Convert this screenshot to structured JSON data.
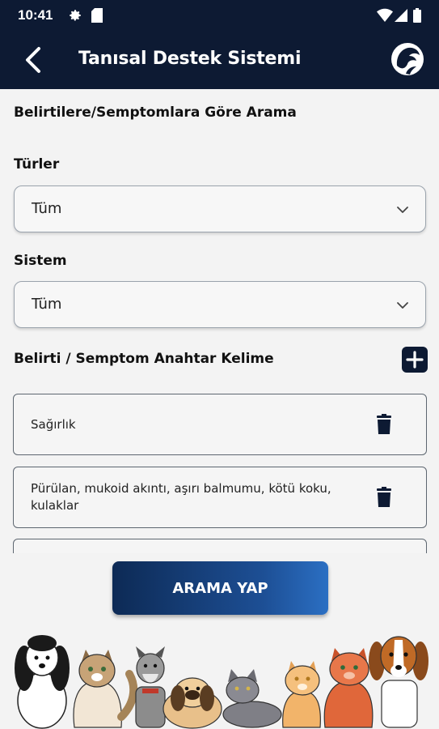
{
  "status_bar": {
    "time": "10:41"
  },
  "header": {
    "title": "Tanısal Destek Sistemi"
  },
  "search": {
    "section_title": "Belirtilere/Semptomlara Göre Arama",
    "species_label": "Türler",
    "species_value": "Tüm",
    "system_label": "Sistem",
    "system_value": "Tüm",
    "keyword_label": "Belirti / Semptom Anahtar Kelime",
    "keywords": [
      "Sağırlık",
      "Pürülan, mukoid akıntı, aşırı balmumu, kötü koku, kulaklar"
    ],
    "button_label": "ARAMA YAP"
  },
  "colors": {
    "primary": "#0d1a33",
    "accent_gradient_end": "#2b6fc3",
    "background": "#f3f3f3"
  }
}
